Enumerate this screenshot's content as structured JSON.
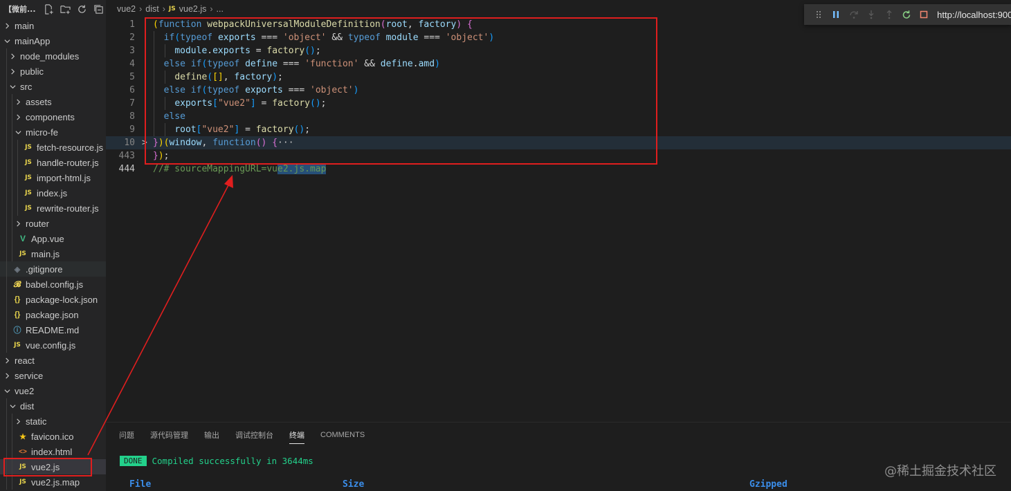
{
  "sidebar": {
    "title": "【微前...",
    "tree": [
      {
        "label": "main",
        "chev": "right",
        "icon": "",
        "level": 0
      },
      {
        "label": "mainApp",
        "chev": "down",
        "icon": "",
        "level": 0
      },
      {
        "label": "node_modules",
        "chev": "right",
        "icon": "",
        "level": 1
      },
      {
        "label": "public",
        "chev": "right",
        "icon": "",
        "level": 1
      },
      {
        "label": "src",
        "chev": "down",
        "icon": "",
        "level": 1
      },
      {
        "label": "assets",
        "chev": "right",
        "icon": "",
        "level": 2
      },
      {
        "label": "components",
        "chev": "right",
        "icon": "",
        "level": 2
      },
      {
        "label": "micro-fe",
        "chev": "down",
        "icon": "",
        "level": 2
      },
      {
        "label": "fetch-resource.js",
        "chev": "",
        "icon": "js",
        "level": 3
      },
      {
        "label": "handle-router.js",
        "chev": "",
        "icon": "js",
        "level": 3
      },
      {
        "label": "import-html.js",
        "chev": "",
        "icon": "js",
        "level": 3
      },
      {
        "label": "index.js",
        "chev": "",
        "icon": "js",
        "level": 3
      },
      {
        "label": "rewrite-router.js",
        "chev": "",
        "icon": "js",
        "level": 3
      },
      {
        "label": "router",
        "chev": "right",
        "icon": "",
        "level": 2
      },
      {
        "label": "App.vue",
        "chev": "",
        "icon": "vue",
        "level": 2
      },
      {
        "label": "main.js",
        "chev": "",
        "icon": "js",
        "level": 2
      },
      {
        "label": ".gitignore",
        "chev": "",
        "icon": "git",
        "level": 1,
        "dim": true
      },
      {
        "label": "babel.config.js",
        "chev": "",
        "icon": "babel",
        "level": 1
      },
      {
        "label": "package-lock.json",
        "chev": "",
        "icon": "json",
        "level": 1
      },
      {
        "label": "package.json",
        "chev": "",
        "icon": "json",
        "level": 1
      },
      {
        "label": "README.md",
        "chev": "",
        "icon": "info",
        "level": 1
      },
      {
        "label": "vue.config.js",
        "chev": "",
        "icon": "js",
        "level": 1
      },
      {
        "label": "react",
        "chev": "right",
        "icon": "",
        "level": 0
      },
      {
        "label": "service",
        "chev": "right",
        "icon": "",
        "level": 0
      },
      {
        "label": "vue2",
        "chev": "down",
        "icon": "",
        "level": 0
      },
      {
        "label": "dist",
        "chev": "down",
        "icon": "",
        "level": 1
      },
      {
        "label": "static",
        "chev": "right",
        "icon": "",
        "level": 2
      },
      {
        "label": "favicon.ico",
        "chev": "",
        "icon": "star",
        "level": 2
      },
      {
        "label": "index.html",
        "chev": "",
        "icon": "html",
        "level": 2
      },
      {
        "label": "vue2.js",
        "chev": "",
        "icon": "js",
        "level": 2,
        "selected": true
      },
      {
        "label": "vue2.js.map",
        "chev": "",
        "icon": "js",
        "level": 2
      }
    ]
  },
  "breadcrumb": {
    "parts": [
      "vue2",
      "dist",
      "vue2.js",
      "..."
    ],
    "file_icon": "JS"
  },
  "debug_toolbar": {
    "url": "http://localhost:900"
  },
  "code": {
    "lines": [
      {
        "num": "1",
        "tokens": [
          [
            "b1",
            "("
          ],
          [
            "k",
            "function "
          ],
          [
            "f",
            "webpackUniversalModuleDefinition"
          ],
          [
            "b2",
            "("
          ],
          [
            "v",
            "root"
          ],
          [
            "p",
            ", "
          ],
          [
            "v",
            "factory"
          ],
          [
            "b2",
            ")"
          ],
          [
            "p",
            " "
          ],
          [
            "b2",
            "{"
          ]
        ]
      },
      {
        "num": "2",
        "tokens": [
          [
            "p",
            "  "
          ],
          [
            "k",
            "if"
          ],
          [
            "b3",
            "("
          ],
          [
            "k",
            "typeof "
          ],
          [
            "v",
            "exports"
          ],
          [
            "p",
            " === "
          ],
          [
            "s",
            "'object'"
          ],
          [
            "p",
            " && "
          ],
          [
            "k",
            "typeof "
          ],
          [
            "v",
            "module"
          ],
          [
            "p",
            " === "
          ],
          [
            "s",
            "'object'"
          ],
          [
            "b3",
            ")"
          ]
        ]
      },
      {
        "num": "3",
        "tokens": [
          [
            "p",
            "    "
          ],
          [
            "v",
            "module"
          ],
          [
            "p",
            "."
          ],
          [
            "v",
            "exports"
          ],
          [
            "p",
            " = "
          ],
          [
            "f",
            "factory"
          ],
          [
            "b3",
            "()"
          ],
          [
            "p",
            ";"
          ]
        ]
      },
      {
        "num": "4",
        "tokens": [
          [
            "p",
            "  "
          ],
          [
            "k",
            "else if"
          ],
          [
            "b3",
            "("
          ],
          [
            "k",
            "typeof "
          ],
          [
            "v",
            "define"
          ],
          [
            "p",
            " === "
          ],
          [
            "s",
            "'function'"
          ],
          [
            "p",
            " && "
          ],
          [
            "v",
            "define"
          ],
          [
            "p",
            "."
          ],
          [
            "v",
            "amd"
          ],
          [
            "b3",
            ")"
          ]
        ]
      },
      {
        "num": "5",
        "tokens": [
          [
            "p",
            "    "
          ],
          [
            "f",
            "define"
          ],
          [
            "b3",
            "("
          ],
          [
            "b1",
            "[]"
          ],
          [
            "p",
            ", "
          ],
          [
            "v",
            "factory"
          ],
          [
            "b3",
            ")"
          ],
          [
            "p",
            ";"
          ]
        ]
      },
      {
        "num": "6",
        "tokens": [
          [
            "p",
            "  "
          ],
          [
            "k",
            "else if"
          ],
          [
            "b3",
            "("
          ],
          [
            "k",
            "typeof "
          ],
          [
            "v",
            "exports"
          ],
          [
            "p",
            " === "
          ],
          [
            "s",
            "'object'"
          ],
          [
            "b3",
            ")"
          ]
        ]
      },
      {
        "num": "7",
        "tokens": [
          [
            "p",
            "    "
          ],
          [
            "v",
            "exports"
          ],
          [
            "b3",
            "["
          ],
          [
            "s",
            "\"vue2\""
          ],
          [
            "b3",
            "]"
          ],
          [
            "p",
            " = "
          ],
          [
            "f",
            "factory"
          ],
          [
            "b3",
            "()"
          ],
          [
            "p",
            ";"
          ]
        ]
      },
      {
        "num": "8",
        "tokens": [
          [
            "p",
            "  "
          ],
          [
            "k",
            "else"
          ]
        ]
      },
      {
        "num": "9",
        "tokens": [
          [
            "p",
            "    "
          ],
          [
            "v",
            "root"
          ],
          [
            "b3",
            "["
          ],
          [
            "s",
            "\"vue2\""
          ],
          [
            "b3",
            "]"
          ],
          [
            "p",
            " = "
          ],
          [
            "f",
            "factory"
          ],
          [
            "b3",
            "()"
          ],
          [
            "p",
            ";"
          ]
        ]
      },
      {
        "num": "10",
        "fold": ">",
        "highlight": true,
        "tokens": [
          [
            "b2",
            "}"
          ],
          [
            "b1",
            ")"
          ],
          [
            "b1",
            "("
          ],
          [
            "v",
            "window"
          ],
          [
            "p",
            ", "
          ],
          [
            "k",
            "function"
          ],
          [
            "b2",
            "()"
          ],
          [
            "p",
            " "
          ],
          [
            "b2",
            "{"
          ],
          [
            "ell",
            "···"
          ]
        ]
      },
      {
        "num": "443",
        "tokens": [
          [
            "b2",
            "}"
          ],
          [
            "b1",
            ")"
          ],
          [
            "p",
            ";"
          ]
        ]
      },
      {
        "num": "444",
        "active": true,
        "tokens": [
          [
            "cm",
            "//# sourceMappingURL=vu"
          ],
          [
            "cmsel",
            "e2.js.map"
          ]
        ]
      }
    ]
  },
  "panel": {
    "tabs": [
      "问题",
      "源代码管理",
      "输出",
      "调试控制台",
      "终端",
      "COMMENTS"
    ],
    "active_tab": 4,
    "done_label": "DONE",
    "compiled_text": "Compiled successfully in 3644ms",
    "table_headers": [
      "File",
      "Size",
      "Gzipped"
    ],
    "watermark": "@稀土掘金技术社区"
  },
  "colors": {
    "annotation": "#e01e1e",
    "done_badge": "#23d18b",
    "keyword": "#569cd6",
    "string": "#ce9178",
    "function": "#dcdcaa",
    "variable": "#9cdcfe"
  }
}
